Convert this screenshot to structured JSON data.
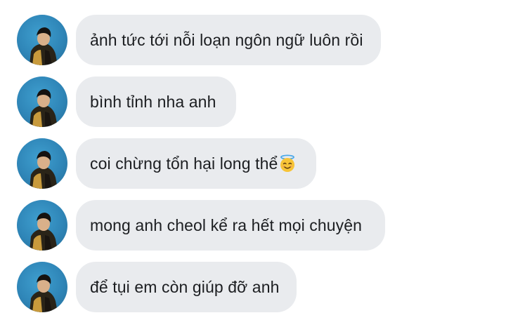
{
  "messages": [
    {
      "text": "ảnh tức tới nỗi loạn ngôn ngữ luôn rồi"
    },
    {
      "text": "bình tỉnh nha anh"
    },
    {
      "text": "coi chừng tổn hại long thể",
      "emoji": "smiling-face-with-halo-icon"
    },
    {
      "text": "mong anh cheol kể ra hết mọi chuyện"
    },
    {
      "text": "để tụi em còn giúp đỡ anh"
    }
  ],
  "colors": {
    "bubble": "#e9ebee",
    "text": "#1c1e21",
    "avatar_bg": "#2f86b8"
  }
}
